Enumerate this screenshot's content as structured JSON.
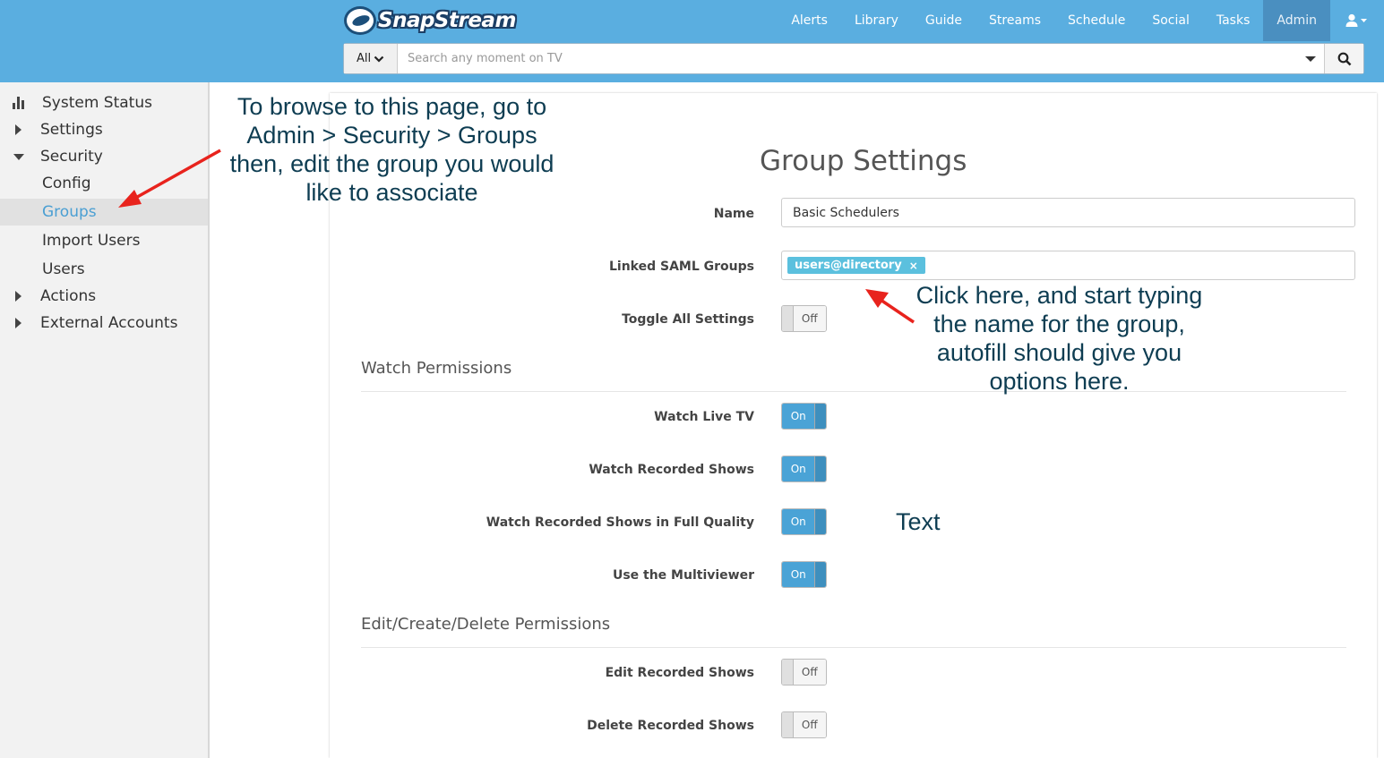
{
  "header": {
    "logo_text": "SnapStream",
    "nav": [
      "Alerts",
      "Library",
      "Guide",
      "Streams",
      "Schedule",
      "Social",
      "Tasks",
      "Admin"
    ],
    "active_nav": "Admin",
    "user_menu_icon": "user-icon",
    "search": {
      "scope": "All",
      "placeholder": "Search any moment on TV"
    }
  },
  "sidebar": {
    "items": [
      {
        "label": "System Status",
        "icon": "bar-chart-icon"
      },
      {
        "label": "Settings",
        "icon": "caret-right-icon"
      },
      {
        "label": "Security",
        "icon": "caret-down-icon"
      },
      {
        "label": "Config"
      },
      {
        "label": "Groups",
        "active": true
      },
      {
        "label": "Import Users"
      },
      {
        "label": "Users"
      },
      {
        "label": "Actions",
        "icon": "caret-right-icon"
      },
      {
        "label": "External Accounts",
        "icon": "caret-right-icon"
      }
    ]
  },
  "main": {
    "title": "Group Settings",
    "name_label": "Name",
    "name_value": "Basic Schedulers",
    "saml_label": "Linked SAML Groups",
    "saml_tag": "users@directory",
    "saml_tag_remove": "×",
    "toggle_all_label": "Toggle All Settings",
    "toggle_all_state": "Off",
    "watch_section": "Watch Permissions",
    "watch_rows": [
      {
        "label": "Watch Live TV",
        "state": "On"
      },
      {
        "label": "Watch Recorded Shows",
        "state": "On"
      },
      {
        "label": "Watch Recorded Shows in Full Quality",
        "state": "On"
      },
      {
        "label": "Use the Multiviewer",
        "state": "On"
      }
    ],
    "edit_section": "Edit/Create/Delete Permissions",
    "edit_rows": [
      {
        "label": "Edit Recorded Shows",
        "state": "Off"
      },
      {
        "label": "Delete Recorded Shows",
        "state": "Off"
      }
    ]
  },
  "annotations": {
    "browse_note": [
      "To browse to this page, go to",
      "Admin > Security > Groups",
      "then, edit the group you would",
      "like to associate"
    ],
    "click_note": [
      "Click here, and start typing",
      "the name for the group,",
      "autofill should give you",
      "options here."
    ],
    "text_note": "Text",
    "arrow_color": "#e8231d"
  },
  "colors": {
    "header": "#5aaee0",
    "active_nav": "#4a8fc0",
    "toggle_on": "#4aa3d6",
    "tag": "#5bc0de",
    "link_active": "#4a9fd3"
  }
}
